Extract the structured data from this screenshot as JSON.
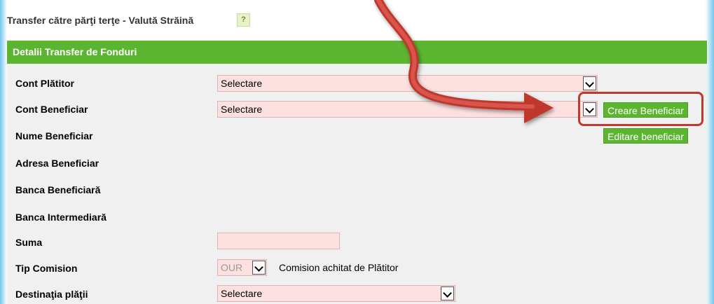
{
  "page": {
    "title": "Transfer către părţi terţe - Valută Străină",
    "help_icon": "?"
  },
  "section": {
    "header": "Detalii Transfer de Fonduri"
  },
  "form": {
    "labels": {
      "cont_platitor": "Cont Plătitor",
      "cont_beneficiar": "Cont Beneficiar",
      "nume_beneficiar": "Nume Beneficiar",
      "adresa_beneficiar": "Adresa Beneficiar",
      "banca_beneficiara": "Banca Beneficiară",
      "banca_intermediara": "Banca Intermediară",
      "suma": "Suma",
      "tip_comision": "Tip Comision",
      "destinatia_platii": "Destinaţia plăţii"
    },
    "cont_platitor_value": "Selectare",
    "cont_beneficiar_value": "Selectare",
    "destinatia_value": "Selectare",
    "tip_comision_value": "OUR",
    "tip_comision_text": "Comision achitat de Plătitor",
    "create_beneficiary_button": "Creare Beneficiar",
    "edit_beneficiary_button": "Editare beneficiar"
  },
  "annotation": {
    "arrow_color": "#c0392b",
    "highlight_color": "#c0392b"
  }
}
